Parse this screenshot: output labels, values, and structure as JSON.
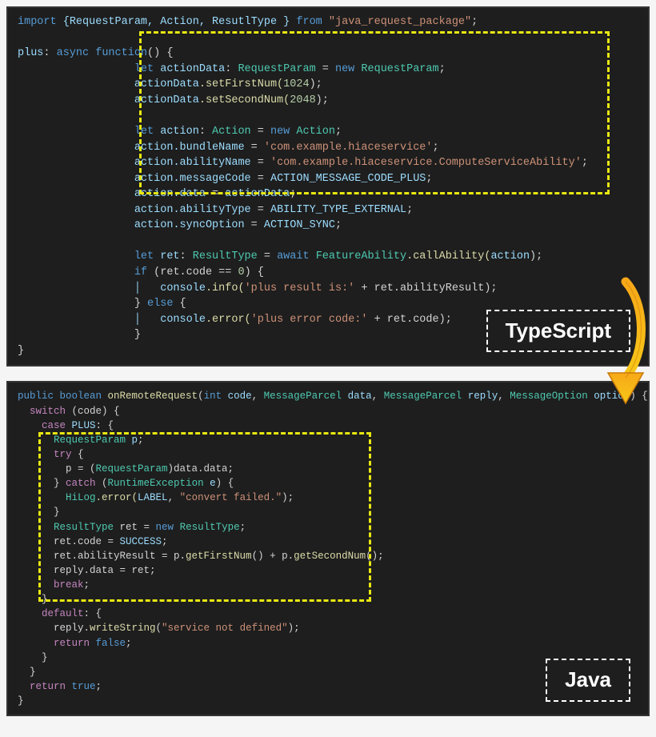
{
  "typescript": {
    "label": "TypeScript",
    "lines": {
      "l1a": "import ",
      "l1b": "{RequestParam, Action, ResutlType } ",
      "l1c": "from ",
      "l1d": "\"java_request_package\"",
      "l1e": ";",
      "l2a": "plus",
      "l2b": ": ",
      "l2c": "async function",
      "l2d": "() {",
      "l3a": "                  let ",
      "l3b": "actionData",
      "l3c": ": ",
      "l3d": "RequestParam",
      "l3e": " = ",
      "l3f": "new ",
      "l3g": "RequestParam",
      "l3h": ";",
      "l4a": "                  actionData",
      "l4b": ".setFirstNum(",
      "l4c": "1024",
      "l4d": ");",
      "l5a": "                  actionData",
      "l5b": ".setSecondNum(",
      "l5c": "2048",
      "l5d": ");",
      "l6a": "                  let ",
      "l6b": "action",
      "l6c": ": ",
      "l6d": "Action",
      "l6e": " = ",
      "l6f": "new ",
      "l6g": "Action",
      "l6h": ";",
      "l7a": "                  action",
      "l7b": ".bundleName",
      "l7c": " = ",
      "l7d": "'com.example.hiaceservice'",
      "l7e": ";",
      "l8a": "                  action",
      "l8b": ".abilityName",
      "l8c": " = ",
      "l8d": "'com.example.hiaceservice.ComputeServiceAbility'",
      "l8e": ";",
      "l9a": "                  action",
      "l9b": ".messageCode",
      "l9c": " = ",
      "l9d": "ACTION_MESSAGE_CODE_PLUS",
      "l9e": ";",
      "l10a": "                  action",
      "l10b": ".data",
      "l10c": " = ",
      "l10d": "actionData",
      "l10e": ";",
      "l11a": "                  action",
      "l11b": ".abilityType",
      "l11c": " = ",
      "l11d": "ABILITY_TYPE_EXTERNAL",
      "l11e": ";",
      "l12a": "                  action",
      "l12b": ".syncOption",
      "l12c": " = ",
      "l12d": "ACTION_SYNC",
      "l12e": ";",
      "l13a": "                  let ",
      "l13b": "ret",
      "l13c": ": ",
      "l13d": "ResultType",
      "l13e": " = ",
      "l13f": "await ",
      "l13g": "FeatureAbility",
      "l13h": ".callAbility(",
      "l13i": "action",
      "l13j": ");",
      "l14a": "                  if ",
      "l14b": "(ret.code == ",
      "l14c": "0",
      "l14d": ") {",
      "l15a": "                  │   console",
      "l15b": ".info(",
      "l15c": "'plus result is:'",
      "l15d": " + ret.abilityResult);",
      "l16a": "                  } ",
      "l16b": "else ",
      "l16c": "{",
      "l17a": "                  │   console",
      "l17b": ".error(",
      "l17c": "'plus error code:'",
      "l17d": " + ret.code);",
      "l18": "                  }",
      "l19": "}"
    }
  },
  "java": {
    "label": "Java",
    "lines": {
      "j1a": "public ",
      "j1b": "boolean ",
      "j1c": "onRemoteRequest",
      "j1d": "(",
      "j1e": "int ",
      "j1f": "code",
      "j1g": ", ",
      "j1h": "MessageParcel ",
      "j1i": "data",
      "j1j": ", ",
      "j1k": "MessageParcel ",
      "j1l": "reply",
      "j1m": ", ",
      "j1n": "MessageOption ",
      "j1o": "option",
      "j1p": ") {",
      "j2a": "  switch ",
      "j2b": "(code) {",
      "j3a": "    case ",
      "j3b": "PLUS",
      "j3c": ": {",
      "j4a": "      RequestParam ",
      "j4b": "p",
      "j4c": ";",
      "j5a": "      try ",
      "j5b": "{",
      "j6a": "        p = (",
      "j6b": "RequestParam",
      "j6c": ")data.data;",
      "j7a": "      } ",
      "j7b": "catch ",
      "j7c": "(",
      "j7d": "RuntimeException ",
      "j7e": "e",
      "j7f": ") {",
      "j8a": "        HiLog",
      "j8b": ".error(",
      "j8c": "LABEL",
      "j8d": ", ",
      "j8e": "\"convert failed.\"",
      "j8f": ");",
      "j9": "      }",
      "j10a": "      ResultType ",
      "j10b": "ret = ",
      "j10c": "new ",
      "j10d": "ResultType",
      "j10e": ";",
      "j11a": "      ret.code = ",
      "j11b": "SUCCESS",
      "j11c": ";",
      "j12a": "      ret.abilityResult = p.",
      "j12b": "getFirstNum",
      "j12c": "() + p.",
      "j12d": "getSecondNum",
      "j12e": "();",
      "j13a": "      reply.data = ret;",
      "j14a": "      break",
      "j14b": ";",
      "j15": "    }",
      "j16a": "    default",
      "j16b": ": {",
      "j17a": "      reply.",
      "j17b": "writeString",
      "j17c": "(",
      "j17d": "\"service not defined\"",
      "j17e": ");",
      "j18a": "      return ",
      "j18b": "false",
      "j18c": ";",
      "j19": "    }",
      "j20": "  }",
      "j21a": "  return ",
      "j21b": "true",
      "j21c": ";",
      "j22": "}"
    }
  }
}
